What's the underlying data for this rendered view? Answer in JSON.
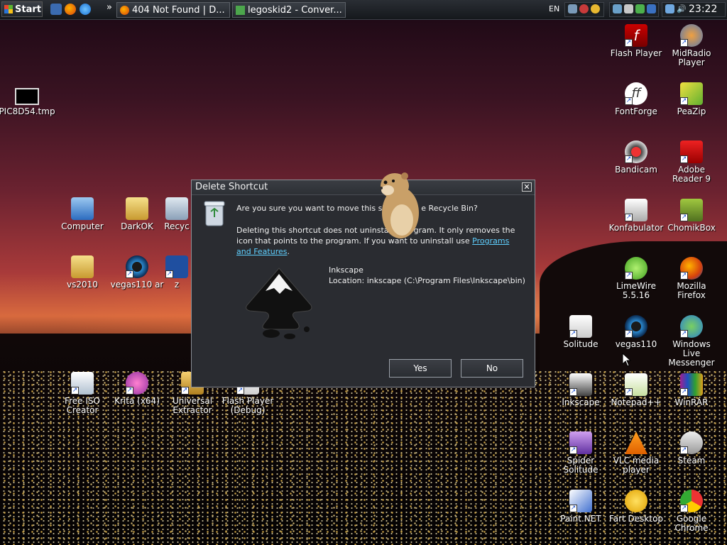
{
  "taskbar": {
    "start_label": "Start",
    "tasks": [
      {
        "label": "404 Not Found | D..."
      },
      {
        "label": "legoskid2 - Conver..."
      }
    ],
    "language": "EN",
    "clock": "23:22"
  },
  "desktop_icons": [
    {
      "label": "PIC8D54.tmp"
    },
    {
      "label": "Computer"
    },
    {
      "label": "DarkOK"
    },
    {
      "label": "Recyc"
    },
    {
      "label": "vs2010"
    },
    {
      "label": "vegas110 ar"
    },
    {
      "label": "z"
    },
    {
      "label": "Free ISO Creator"
    },
    {
      "label": "Krita (x64)"
    },
    {
      "label": "Universal Extractor"
    },
    {
      "label": "Flash Player (Debug)"
    },
    {
      "label": "Flash Player"
    },
    {
      "label": "MidRadio Player"
    },
    {
      "label": "FontForge"
    },
    {
      "label": "PeaZip"
    },
    {
      "label": "Bandicam"
    },
    {
      "label": "Adobe Reader 9"
    },
    {
      "label": "Konfabulator"
    },
    {
      "label": "ChomikBox"
    },
    {
      "label": "LimeWire 5.5.16"
    },
    {
      "label": "Mozilla Firefox"
    },
    {
      "label": "Solitude"
    },
    {
      "label": "vegas110"
    },
    {
      "label": "Windows Live Messenger"
    },
    {
      "label": "Inkscape"
    },
    {
      "label": "Notepad++"
    },
    {
      "label": "WinRAR"
    },
    {
      "label": "Spider Solitude"
    },
    {
      "label": "VLC media player"
    },
    {
      "label": "Steam"
    },
    {
      "label": "Paint.NET"
    },
    {
      "label": "Fart Desktop"
    },
    {
      "label": "Google Chrome"
    }
  ],
  "dialog": {
    "title": "Delete Shortcut",
    "close_label": "✕",
    "question": "Are you sure you want to move this sh",
    "question_tail": "e Recycle Bin?",
    "body_part1": "Deleting this shortcut does not uninstal",
    "body_part2": "gram. It only removes the icon that points to the program. If you want to uninstall use ",
    "link_text": "Programs and Features",
    "body_end": ".",
    "item_name": "Inkscape",
    "item_location": "Location: inkscape (C:\\Program Files\\Inkscape\\bin)",
    "yes_label": "Yes",
    "no_label": "No"
  },
  "colors": {
    "dialog_bg": "#2a2c31",
    "link": "#5fd0ff",
    "taskbar_bg": "#1c2024"
  }
}
